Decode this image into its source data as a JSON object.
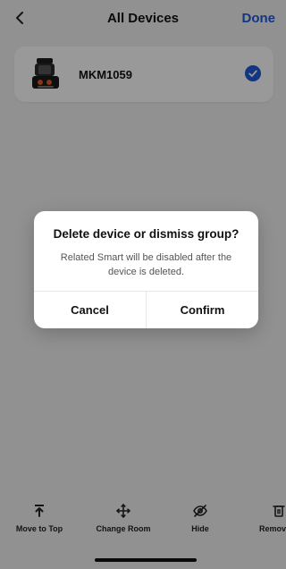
{
  "header": {
    "title": "All Devices",
    "done_label": "Done"
  },
  "device": {
    "name": "MKM1059",
    "selected": true
  },
  "dialog": {
    "title": "Delete device or dismiss group?",
    "message": "Related Smart will be disabled after the device is deleted.",
    "cancel_label": "Cancel",
    "confirm_label": "Confirm"
  },
  "toolbar": {
    "items": [
      {
        "label": "Move to Top",
        "icon": "move-to-top-icon"
      },
      {
        "label": "Change Room",
        "icon": "move-icon"
      },
      {
        "label": "Hide",
        "icon": "eye-off-icon"
      },
      {
        "label": "Remove D",
        "icon": "trash-icon"
      }
    ]
  },
  "colors": {
    "accent": "#1f5bd8",
    "background": "#f2f2f4",
    "card": "#ffffff",
    "overlay": "rgba(0,0,0,0.40)"
  }
}
